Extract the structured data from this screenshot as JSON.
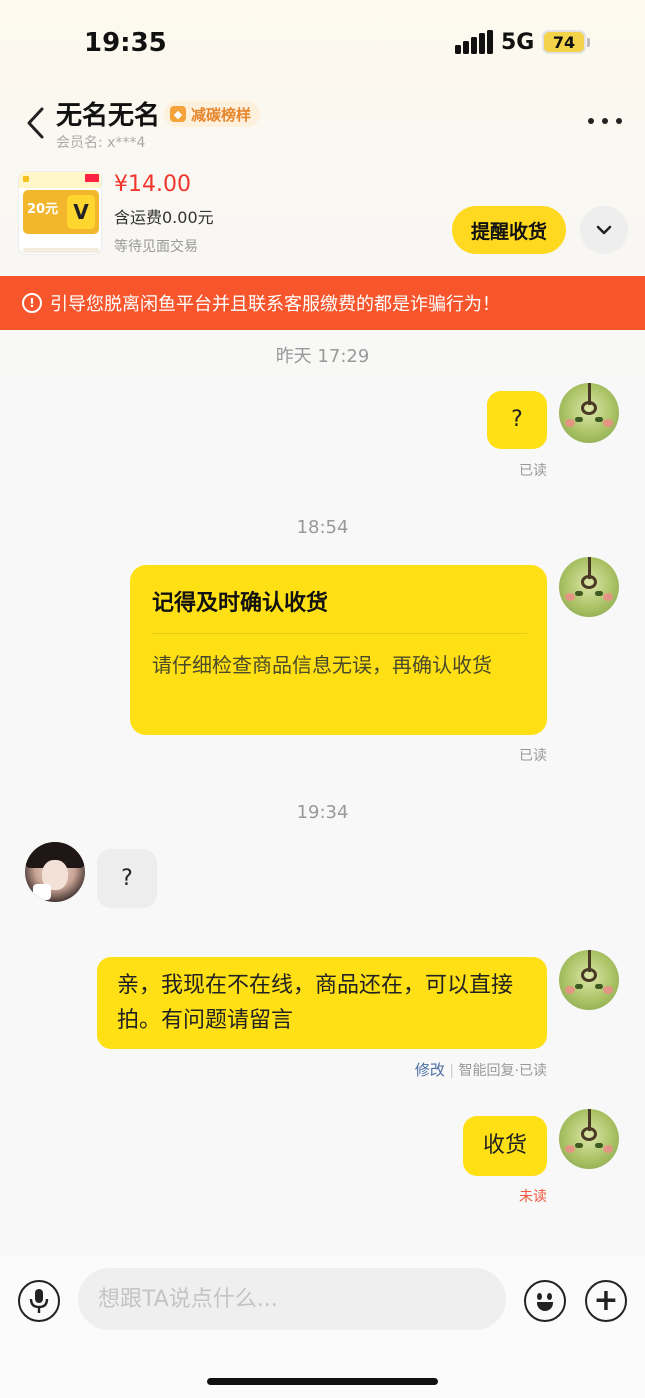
{
  "status_bar": {
    "time": "19:35",
    "network": "5G",
    "battery": "74"
  },
  "header": {
    "title": "无名无名",
    "badge": "减碳榜样",
    "member_label": "会员名: x***4"
  },
  "product": {
    "thumb_text": "20元",
    "price": "¥14.00",
    "shipping": "含运费0.00元",
    "status": "等待见面交易",
    "remind_button": "提醒收货"
  },
  "warning": "引导您脱离闲鱼平台并且联系客服缴费的都是诈骗行为！",
  "chat": {
    "time1": "昨天 17:29",
    "msg1": "?",
    "read1": "已读",
    "time2": "18:54",
    "card_title": "记得及时确认收货",
    "card_body": "请仔细检查商品信息无误，再确认收货",
    "read2": "已读",
    "time3": "19:34",
    "msg_her": "?",
    "msg3": "亲，我现在不在线，商品还在，可以直接拍。有问题请留言",
    "edit": "修改",
    "read3": "智能回复·已读",
    "msg4": "收货",
    "read4": "未读"
  },
  "input": {
    "placeholder": "想跟TA说点什么..."
  },
  "colors": {
    "accent": "#ffe014",
    "warning": "#f7552c",
    "price": "#f0362d"
  }
}
